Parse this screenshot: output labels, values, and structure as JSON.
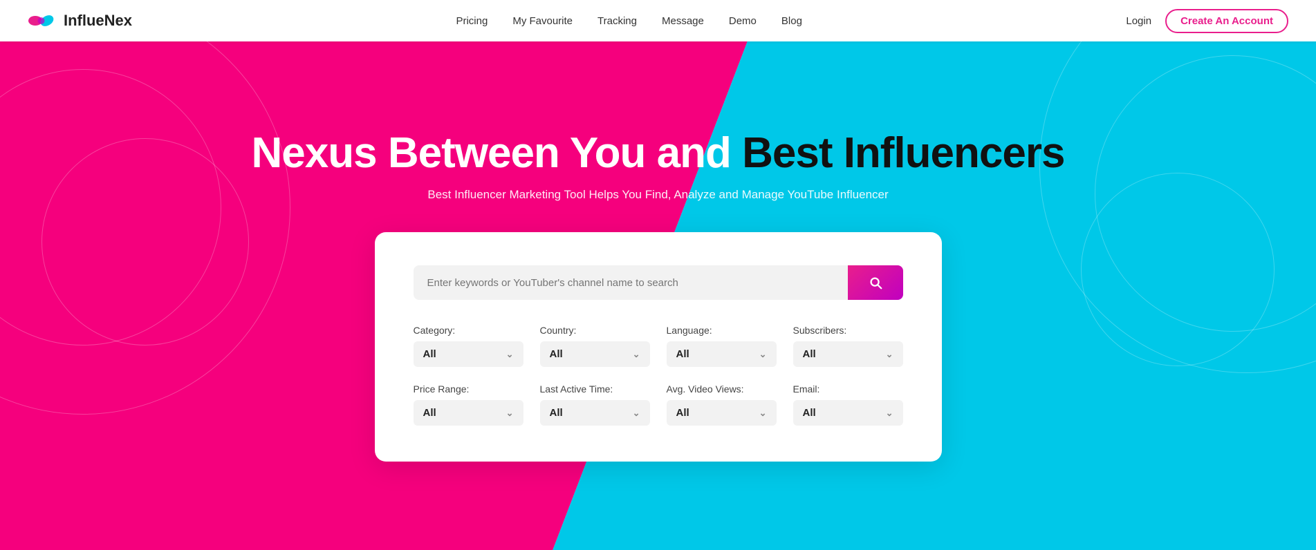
{
  "navbar": {
    "brand": "InflueNex",
    "nav_items": [
      {
        "label": "Pricing",
        "href": "#"
      },
      {
        "label": "My Favourite",
        "href": "#"
      },
      {
        "label": "Tracking",
        "href": "#"
      },
      {
        "label": "Message",
        "href": "#"
      },
      {
        "label": "Demo",
        "href": "#"
      },
      {
        "label": "Blog",
        "href": "#"
      }
    ],
    "login_label": "Login",
    "create_account_label": "Create An Account"
  },
  "hero": {
    "title_part1": "Nexus Between You and ",
    "title_part2": "Best Influencers",
    "subtitle": "Best Influencer Marketing Tool Helps You Find, Analyze and Manage YouTube Influencer"
  },
  "search": {
    "placeholder": "Enter keywords or YouTuber's channel name to search"
  },
  "filters": [
    {
      "id": "category",
      "label": "Category:",
      "value": "All"
    },
    {
      "id": "country",
      "label": "Country:",
      "value": "All"
    },
    {
      "id": "language",
      "label": "Language:",
      "value": "All"
    },
    {
      "id": "subscribers",
      "label": "Subscribers:",
      "value": "All"
    },
    {
      "id": "price-range",
      "label": "Price Range:",
      "value": "All"
    },
    {
      "id": "last-active-time",
      "label": "Last Active Time:",
      "value": "All"
    },
    {
      "id": "avg-video-views",
      "label": "Avg. Video Views:",
      "value": "All"
    },
    {
      "id": "email",
      "label": "Email:",
      "value": "All"
    }
  ],
  "colors": {
    "accent_pink": "#e91e8c",
    "accent_cyan": "#00c8e8",
    "bg_left": "#f5007d",
    "bg_right": "#00c8e8"
  }
}
